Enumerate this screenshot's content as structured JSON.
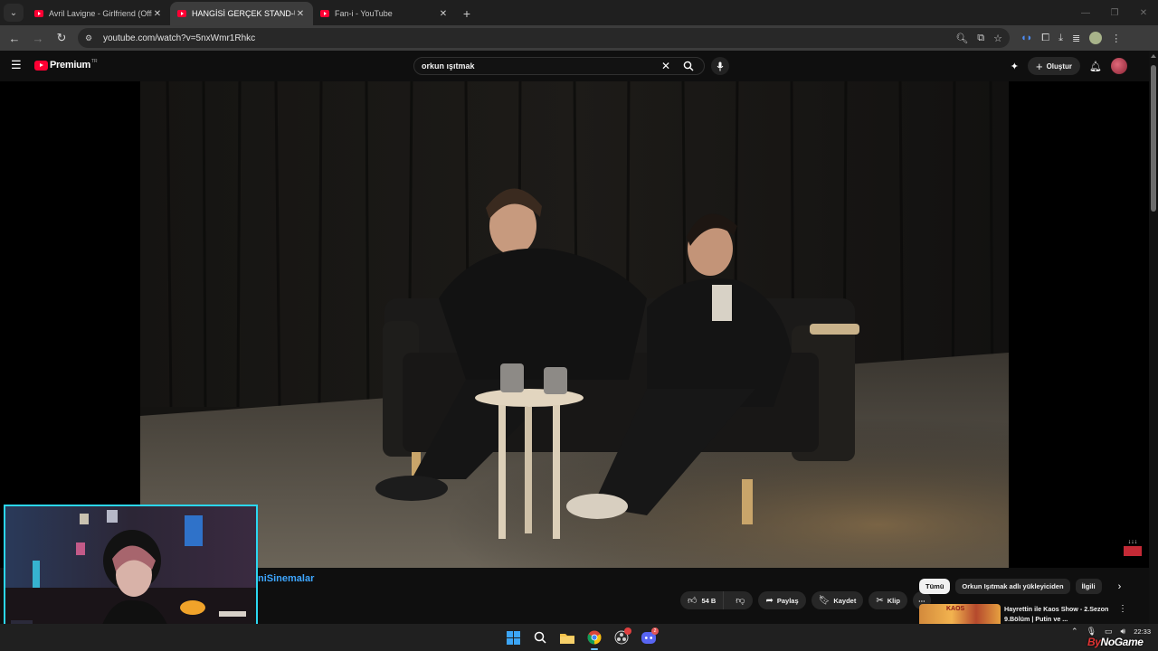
{
  "browser": {
    "tabs": [
      {
        "label": "Avril Lavigne - Girlfriend (Offici",
        "active": false
      },
      {
        "label": "HANGİSİ GERÇEK STAND-UP K",
        "active": true
      },
      {
        "label": "Fan-i - YouTube",
        "active": false
      }
    ],
    "tab_close": "✕",
    "new_tab": "+",
    "url": "youtube.com/watch?v=5nxWmr1Rhkc"
  },
  "youtube": {
    "brand": "Premium",
    "region": "TR",
    "search_value": "orkun ışıtmak",
    "create_label": "Oluştur"
  },
  "video": {
    "watermark_text": "↓↓↓"
  },
  "below": {
    "channel_name": "niSinemalar",
    "likes": "54 B",
    "share_label": "Paylaş",
    "save_label": "Kaydet",
    "clip_label": "Klip",
    "more": "⋯"
  },
  "chips": [
    "Tümü",
    "Orkun Işıtmak adlı yükleyiciden",
    "İlgili"
  ],
  "recommendation": {
    "thumb_text": "KAOS",
    "title": "Hayrettin ile Kaos Show - 2.Sezon 9.Bölüm | Putin ve ..."
  },
  "taskbar": {
    "discord_badge": "2",
    "clock_time": "22:33"
  },
  "overlay": {
    "brand_prefix": "By",
    "brand_main": "NoGame"
  },
  "colors": {
    "accent_blue": "#3ea6ff",
    "youtube_red": "#ff0033",
    "webcam_border": "#2bd7f2"
  }
}
